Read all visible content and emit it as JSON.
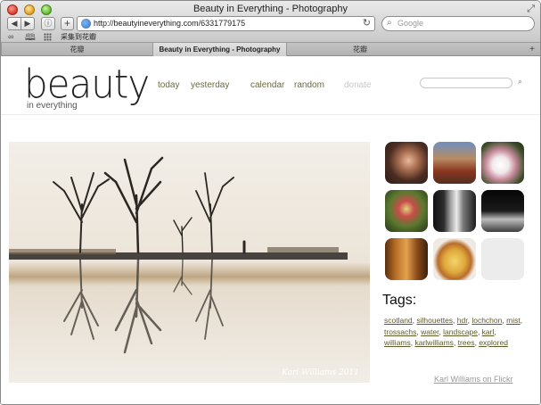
{
  "browser": {
    "window_title": "Beauty in Everything - Photography",
    "url": "http://beautyineverything.com/6331779175",
    "search_placeholder": "Google",
    "bookmark_item": "采集到花瓣",
    "tabs": [
      {
        "label": "花瓣",
        "active": false
      },
      {
        "label": "Beauty in Everything - Photography",
        "active": true
      },
      {
        "label": "花瓣",
        "active": false
      }
    ],
    "icons": {
      "back": "chevron-left-icon",
      "forward": "chevron-right-icon",
      "reader": "reader-icon",
      "add": "plus-icon",
      "globe": "globe-icon",
      "reload": "reload-icon",
      "search": "search-icon",
      "new_tab": "plus-icon",
      "resize": "resize-icon"
    }
  },
  "site": {
    "logo": "beauty",
    "logo_sub": "in everything",
    "nav": {
      "today": "today",
      "yesterday": "yesterday",
      "calendar": "calendar",
      "random": "random",
      "donate": "donate"
    },
    "photo_credit": "Karl Williams 2011",
    "tags_heading": "Tags:",
    "tags": [
      "scotland",
      "silhouettes",
      "hdr",
      "lochchon",
      "mist",
      "trossachs",
      "water",
      "landscape",
      "karl",
      "williams",
      "karlwilliams",
      "trees",
      "explored"
    ],
    "flickr_link": "Karl Williams on Flickr"
  },
  "colors": {
    "nav_link": "#6b6a3e",
    "nav_disabled": "#c8c8c8",
    "tag_link": "#5d5a2c"
  }
}
